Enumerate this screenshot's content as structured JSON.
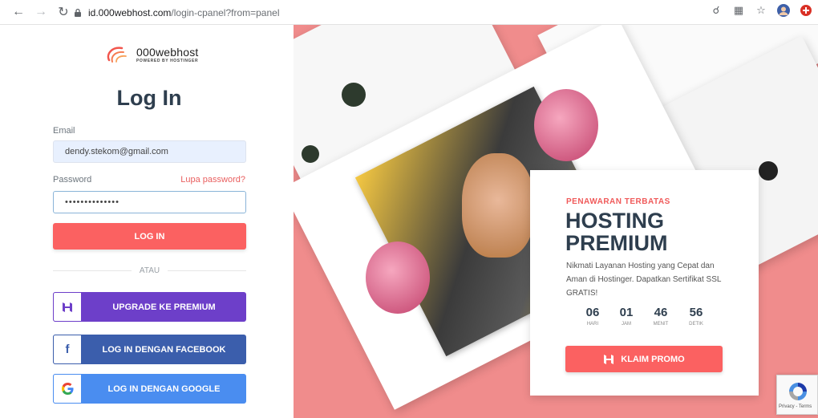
{
  "browser": {
    "url_host": "id.000webhost.com",
    "url_path": "/login-cpanel?from=panel"
  },
  "logo": {
    "name": "000webhost",
    "sub": "POWERED BY HOSTINGER"
  },
  "login": {
    "title": "Log In",
    "email_label": "Email",
    "email_value": "dendy.stekom@gmail.com",
    "password_label": "Password",
    "forgot_label": "Lupa password?",
    "password_value": "••••••••••••••",
    "login_button": "LOG IN",
    "divider": "ATAU",
    "premium_button": "UPGRADE KE PREMIUM",
    "facebook_button": "LOG IN DENGAN FACEBOOK",
    "google_button": "LOG IN DENGAN GOOGLE"
  },
  "promo": {
    "eyebrow": "PENAWARAN TERBATAS",
    "headline_1": "HOSTING",
    "headline_2": "PREMIUM",
    "description": "Nikmati Layanan Hosting yang Cepat dan Aman di Hostinger. Dapatkan Sertifikat SSL GRATIS!",
    "countdown": [
      {
        "value": "06",
        "unit": "HARI"
      },
      {
        "value": "01",
        "unit": "JAM"
      },
      {
        "value": "46",
        "unit": "MENIT"
      },
      {
        "value": "56",
        "unit": "DETIK"
      }
    ],
    "button": "KLAIM PROMO"
  },
  "recaptcha": {
    "text": "Privacy - Terms"
  },
  "colors": {
    "accent": "#fb6161",
    "premium": "#6d3fc9",
    "facebook": "#3b5eac",
    "google": "#4a8df0",
    "promo_bg": "#f08c8c"
  }
}
